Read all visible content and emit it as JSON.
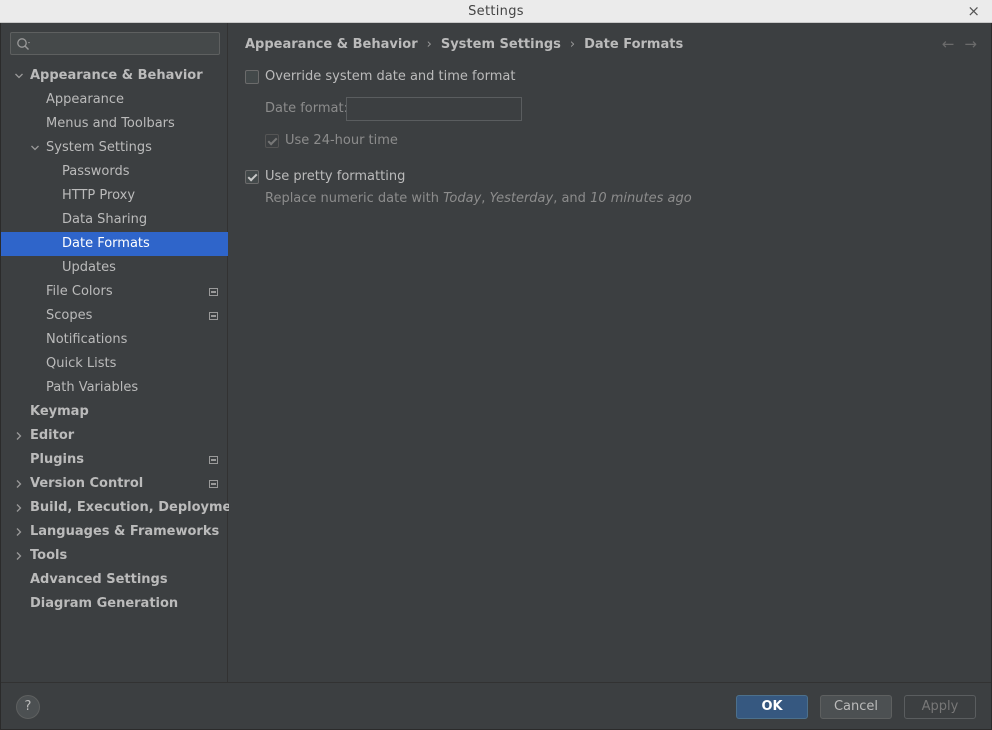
{
  "window": {
    "title": "Settings",
    "close_glyph": "×"
  },
  "search": {
    "placeholder": "",
    "icon": "search-icon"
  },
  "sidebar": {
    "items": [
      {
        "label": "Appearance & Behavior",
        "level": 0,
        "bold": true,
        "expander": "expanded"
      },
      {
        "label": "Appearance",
        "level": 1
      },
      {
        "label": "Menus and Toolbars",
        "level": 1
      },
      {
        "label": "System Settings",
        "level": 1,
        "expander": "expanded"
      },
      {
        "label": "Passwords",
        "level": 2
      },
      {
        "label": "HTTP Proxy",
        "level": 2
      },
      {
        "label": "Data Sharing",
        "level": 2
      },
      {
        "label": "Date Formats",
        "level": 2,
        "selected": true
      },
      {
        "label": "Updates",
        "level": 2
      },
      {
        "label": "File Colors",
        "level": 1,
        "badge": true
      },
      {
        "label": "Scopes",
        "level": 1,
        "badge": true
      },
      {
        "label": "Notifications",
        "level": 1
      },
      {
        "label": "Quick Lists",
        "level": 1
      },
      {
        "label": "Path Variables",
        "level": 1
      },
      {
        "label": "Keymap",
        "level": 0,
        "bold": true
      },
      {
        "label": "Editor",
        "level": 0,
        "bold": true,
        "expander": "collapsed"
      },
      {
        "label": "Plugins",
        "level": 0,
        "bold": true,
        "badge": true
      },
      {
        "label": "Version Control",
        "level": 0,
        "bold": true,
        "expander": "collapsed",
        "badge": true
      },
      {
        "label": "Build, Execution, Deployment",
        "level": 0,
        "bold": true,
        "expander": "collapsed"
      },
      {
        "label": "Languages & Frameworks",
        "level": 0,
        "bold": true,
        "expander": "collapsed"
      },
      {
        "label": "Tools",
        "level": 0,
        "bold": true,
        "expander": "collapsed"
      },
      {
        "label": "Advanced Settings",
        "level": 0,
        "bold": true
      },
      {
        "label": "Diagram Generation",
        "level": 0,
        "bold": true
      }
    ]
  },
  "breadcrumb": {
    "parts": [
      "Appearance & Behavior",
      "System Settings",
      "Date Formats"
    ],
    "separator": "›"
  },
  "nav": {
    "back": "←",
    "forward": "→"
  },
  "options": {
    "override_label": "Override system date and time format",
    "override_checked": false,
    "date_format_label": "Date format:",
    "date_format_value": "",
    "use_24h_label": "Use 24-hour time",
    "use_24h_checked": true,
    "pretty_label": "Use pretty formatting",
    "pretty_checked": true,
    "hint_prefix": "Replace numeric date with ",
    "hint_today": "Today",
    "hint_comma1": ", ",
    "hint_yesterday": "Yesterday",
    "hint_and": ", and ",
    "hint_ago": "10 minutes ago"
  },
  "footer": {
    "help": "?",
    "ok": "OK",
    "cancel": "Cancel",
    "apply": "Apply"
  },
  "colors": {
    "background": "#3c3f41",
    "selection": "#2f65ca",
    "primary_button": "#365880"
  }
}
